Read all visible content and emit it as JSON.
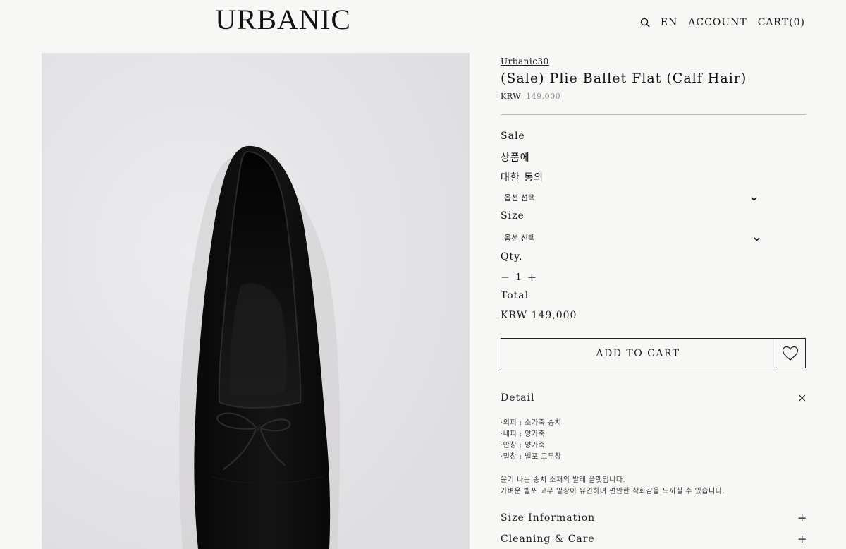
{
  "header": {
    "logo": "URBANIC",
    "lang": "EN",
    "account": "ACCOUNT",
    "cart": "CART(0)"
  },
  "product": {
    "brand": "Urbanic30",
    "title": "(Sale) Plie Ballet Flat (Calf Hair)",
    "currency": "KRW",
    "price": "149,000"
  },
  "options": {
    "sale_label": "Sale",
    "agree_line1": "상품에",
    "agree_line2": "대한 동의",
    "select_1": "옵션 선택",
    "size_label": "Size",
    "select_2": "옵션 선택",
    "qty_label": "Qty.",
    "qty_minus": "−",
    "qty_value": "1",
    "qty_plus": "+",
    "total_label": "Total",
    "total_value": "KRW 149,000"
  },
  "actions": {
    "add_to_cart": "ADD TO CART"
  },
  "detail": {
    "title": "Detail",
    "toggle": "×",
    "specs": [
      "·외피 : 소가죽 송치",
      "·내피 : 양가죽",
      "·안창 : 양가죽",
      "·밑창 : 벨포 고무창"
    ],
    "desc": [
      "윤기 나는 송치 소재의 발레 플랫입니다.",
      "가벼운 벨포 고무 밑창이 유연하며 편안한 착화감을 느끼실 수 있습니다."
    ]
  },
  "accordions": [
    {
      "title": "Size Information",
      "toggle": "+"
    },
    {
      "title": "Cleaning & Care",
      "toggle": "+"
    }
  ],
  "colors": {
    "background": "#f7f7f6",
    "text": "#1a1a1a",
    "photo_bg": "#e6e5e7",
    "shoe": "#0d0d0d"
  },
  "icons": {
    "search": "search-icon",
    "wishlist": "heart-icon",
    "select": "chevron-down-icon"
  }
}
